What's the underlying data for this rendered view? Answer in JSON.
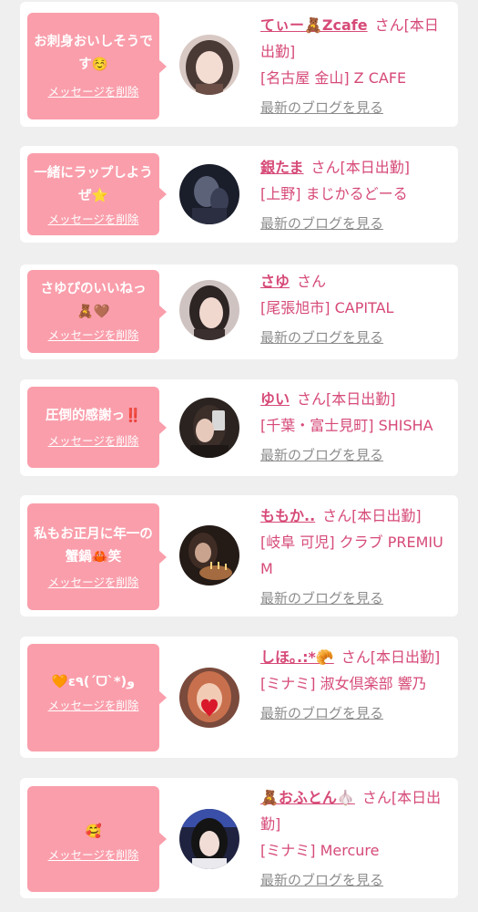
{
  "theme": {
    "bubble_color": "#fa9eab",
    "name_color": "#d64a77",
    "link_gray": "#8c8c8c",
    "background": "#efefef"
  },
  "cards": [
    {
      "message": "お刺身おいしそうです☺️",
      "delete_label": "メッセージを削除",
      "name": "てぃー🧸Zcafe",
      "suffix": "さん[本日出勤]",
      "location": "[名古屋 金山] Z CAFE",
      "blog_label": "最新のブログを見る",
      "avatar_icon": "girl-portrait-icon"
    },
    {
      "message": "一緒にラップしようぜ⭐️",
      "delete_label": "メッセージを削除",
      "name": "銀たま",
      "suffix": "さん[本日出勤]",
      "location": "[上野] まじかるどーる",
      "blog_label": "最新のブログを見る",
      "avatar_icon": "girl-portrait-icon"
    },
    {
      "message": "さゆぴのいいねっ🧸🤎",
      "delete_label": "メッセージを削除",
      "name": "さゆ",
      "suffix": "さん",
      "location": "[尾張旭市] CAPITAL",
      "blog_label": "最新のブログを見る",
      "avatar_icon": "girl-portrait-icon"
    },
    {
      "message": "圧倒的感謝っ‼️",
      "delete_label": "メッセージを削除",
      "name": "ゆい",
      "suffix": "さん[本日出勤]",
      "location": "[千葉・富士見町] SHISHA",
      "blog_label": "最新のブログを見る",
      "avatar_icon": "girl-portrait-icon"
    },
    {
      "message": "私もお正月に年一の蟹鍋🦀笑",
      "delete_label": "メッセージを削除",
      "name": "ももか..",
      "suffix": "さん[本日出勤]",
      "location": "[岐阜 可児] クラブ PREMIUM",
      "blog_label": "最新のブログを見る",
      "avatar_icon": "girl-portrait-icon"
    },
    {
      "message": "🧡ε٩(ˊᗜˋ*)و",
      "delete_label": "メッセージを削除",
      "name": "しほ｡.:*🥐",
      "suffix": "さん[本日出勤]",
      "location": "[ミナミ] 淑女倶楽部 響乃",
      "blog_label": "最新のブログを見る",
      "avatar_icon": "girl-portrait-icon"
    },
    {
      "message": "🥰",
      "delete_label": "メッセージを削除",
      "name": "🧸おふとん🧄",
      "suffix": "さん[本日出勤]",
      "location": "[ミナミ] Mercure",
      "blog_label": "最新のブログを見る",
      "avatar_icon": "girl-portrait-icon"
    }
  ]
}
